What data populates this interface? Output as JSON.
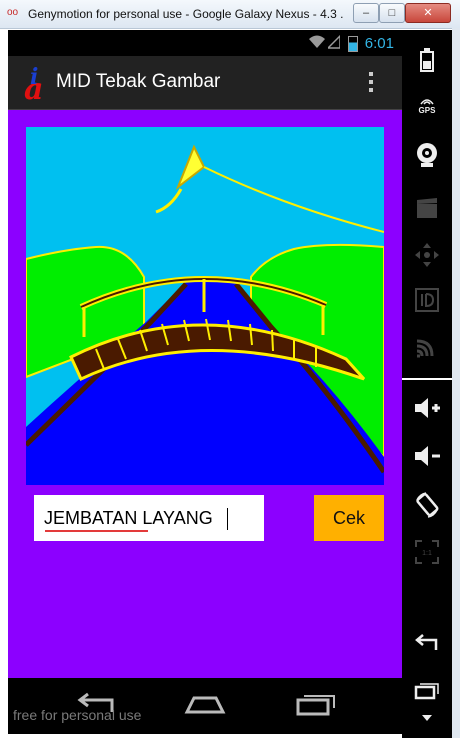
{
  "window": {
    "title": "Genymotion for personal use - Google Galaxy Nexus - 4.3 ...",
    "logo": "oo",
    "minimize_glyph": "–",
    "maximize_glyph": "□",
    "close_glyph": "✕"
  },
  "statusbar": {
    "time": "6:01",
    "icons": [
      "wifi-icon",
      "signal-icon",
      "battery-icon"
    ]
  },
  "actionbar": {
    "title": "MID Tebak Gambar",
    "icon_letters": {
      "a": "a",
      "i": "i"
    }
  },
  "picture": {
    "content": "bridge drawing",
    "colors": {
      "sky": "#00c0f0",
      "grass": "#00ee00",
      "river": "#0000ff",
      "kite": "#ffff33",
      "bridge": "#4a1a00",
      "background": "#8c00ff"
    }
  },
  "answer": {
    "value": "JEMBATAN LAYANG"
  },
  "check_button": {
    "label": "Cek",
    "color": "#ffb000"
  },
  "navbar": {
    "watermark": "free for personal use",
    "buttons": [
      "back-icon",
      "home-icon",
      "recent-apps-icon"
    ]
  },
  "sidebar": {
    "gps_label": "GPS",
    "tools": [
      "battery-icon",
      "gps-icon",
      "camera-icon",
      "video-icon",
      "dpad-icon",
      "id-icon",
      "cast-icon",
      "volume-up-icon",
      "volume-down-icon",
      "rotate-icon",
      "scale-icon",
      "back-icon",
      "recent-apps-icon",
      "menu-icon"
    ]
  }
}
